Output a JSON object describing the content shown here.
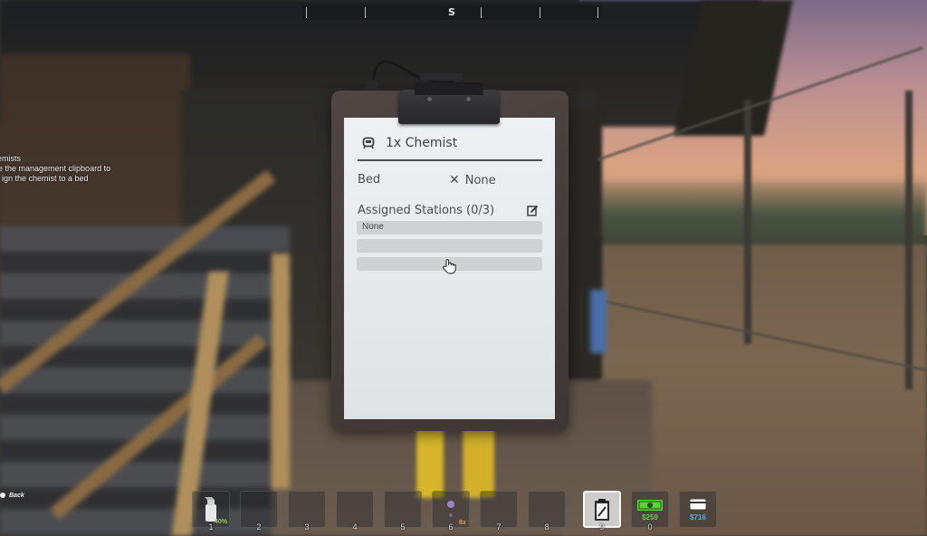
{
  "compass": {
    "heading": "S"
  },
  "objective": {
    "title": "emists",
    "line1": "e the management clipboard to",
    "line2": "ign the chemist to a bed"
  },
  "back_hint": "Back",
  "clipboard": {
    "title": "1x Chemist",
    "title_icon": "chemist-icon",
    "bed": {
      "label": "Bed",
      "value": "None",
      "icon": "x-icon"
    },
    "stations": {
      "label": "Assigned Stations (0/3)",
      "edit_icon": "edit-icon",
      "slots": [
        "None",
        "",
        ""
      ]
    }
  },
  "hotbar": {
    "slots": [
      {
        "number": "1",
        "badge": "40%",
        "icon": "spray-bottle-icon"
      },
      {
        "number": "2"
      },
      {
        "number": "3"
      },
      {
        "number": "4"
      },
      {
        "number": "5"
      },
      {
        "number": "6",
        "badge": "8x",
        "icon": "item-icon"
      },
      {
        "number": "7"
      },
      {
        "number": "8"
      },
      {
        "number": "9",
        "selected": true,
        "icon": "clipboard-icon"
      },
      {
        "number": "0",
        "cash": "$259",
        "icon": "cash-icon"
      },
      {
        "card": "$716",
        "icon": "card-icon"
      }
    ]
  },
  "colors": {
    "paper": "#eef1f3",
    "ink": "#4a4c4f",
    "cash_green": "#5cd13a",
    "card_blue": "#4fb0e8",
    "badge_green": "#8fd14a",
    "badge_orange": "#e0a040"
  }
}
